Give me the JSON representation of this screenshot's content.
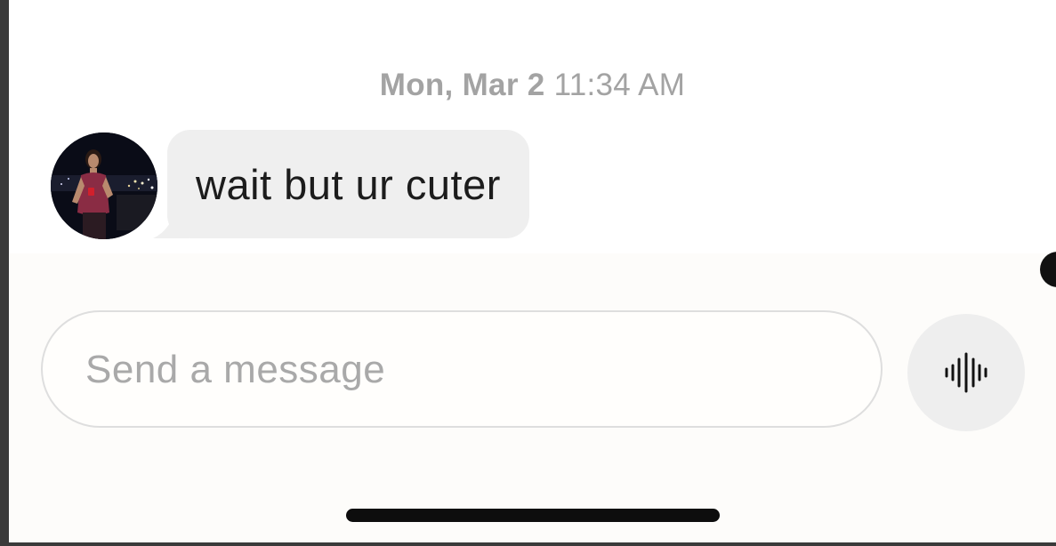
{
  "conversation": {
    "timestamp": {
      "date": "Mon, Mar 2",
      "time": "11:34 AM"
    },
    "messages": [
      {
        "sender": "contact",
        "text": "wait but ur cuter"
      }
    ]
  },
  "composer": {
    "placeholder": "Send a message",
    "value": ""
  },
  "icons": {
    "voice": "voice-waveform-icon"
  },
  "colors": {
    "background": "#fdfcfa",
    "bubble": "#efefef",
    "timestamp_text": "#a3a3a3",
    "placeholder_text": "#a9a9a9"
  }
}
